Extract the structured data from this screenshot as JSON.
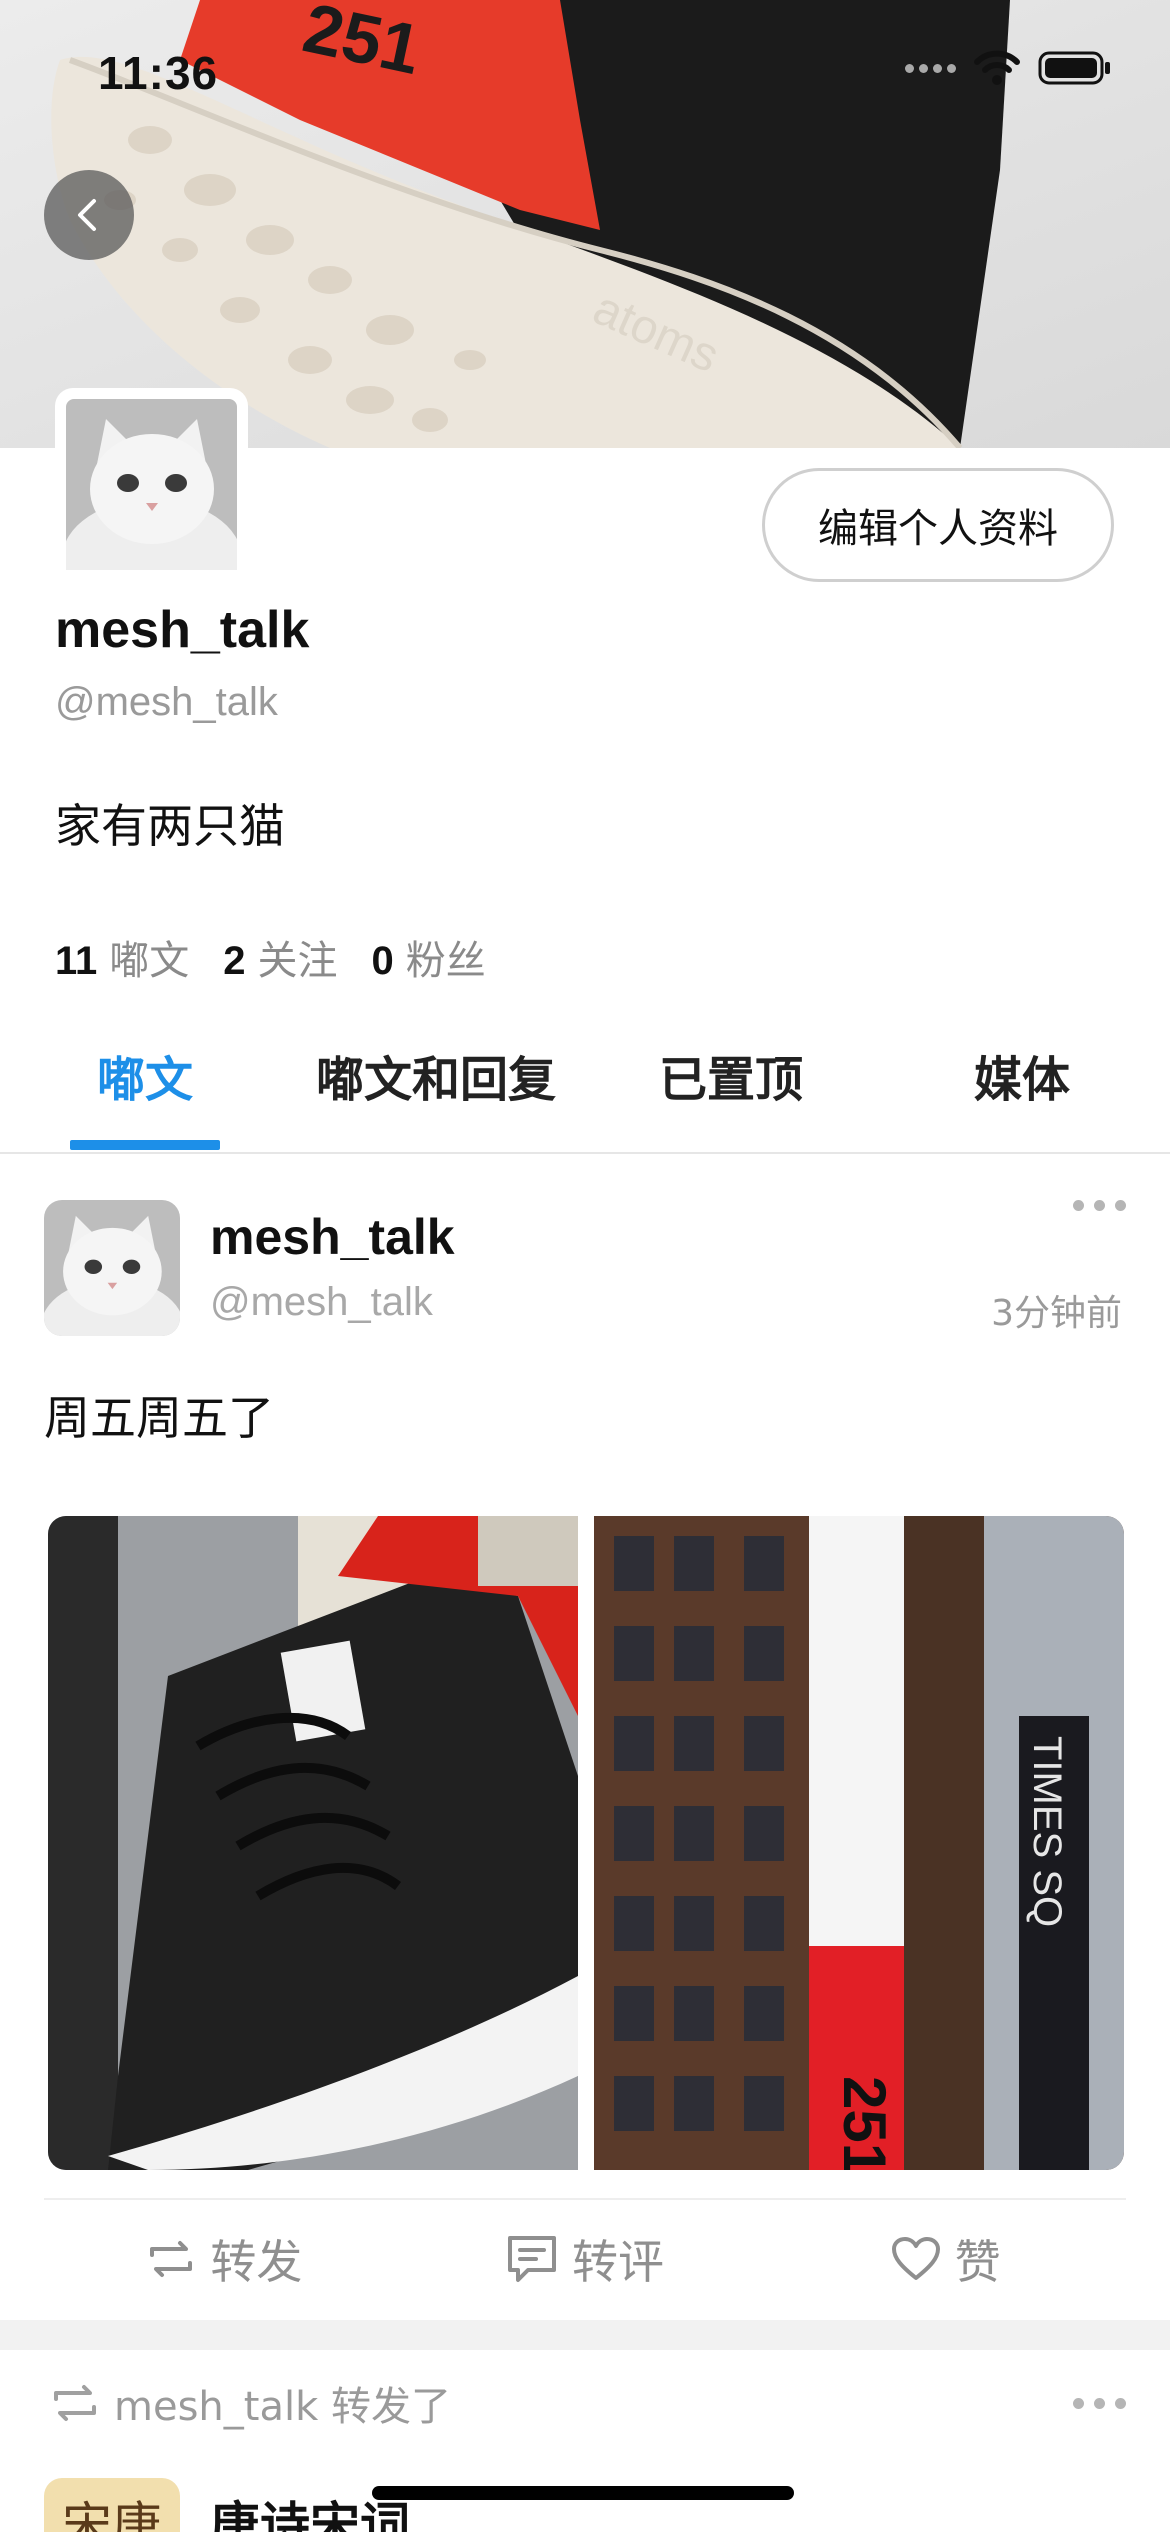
{
  "status_bar": {
    "time": "11:36"
  },
  "profile": {
    "display_name": "mesh_talk",
    "handle": "@mesh_talk",
    "bio": "家有两只猫",
    "edit_button": "编辑个人资料",
    "stats": [
      {
        "count": "11",
        "label": "嘟文"
      },
      {
        "count": "2",
        "label": "关注"
      },
      {
        "count": "0",
        "label": "粉丝"
      }
    ]
  },
  "tabs": [
    {
      "label": "嘟文",
      "active": true
    },
    {
      "label": "嘟文和回复",
      "active": false
    },
    {
      "label": "已置顶",
      "active": false
    },
    {
      "label": "媒体",
      "active": false
    }
  ],
  "post": {
    "author": "mesh_talk",
    "handle": "@mesh_talk",
    "time": "3分钟前",
    "text": "周五周五了",
    "images": [
      "sneaker-photo",
      "times-square-billboard-photo"
    ],
    "actions": {
      "repost": "转发",
      "comment": "转评",
      "like": "赞"
    }
  },
  "retweet": {
    "by_text": "mesh_talk 转发了",
    "author": "唐诗宋词",
    "avatar_text": "宋唐"
  },
  "colors": {
    "accent": "#1d8fe8",
    "shoe_red": "#e63b2a"
  }
}
